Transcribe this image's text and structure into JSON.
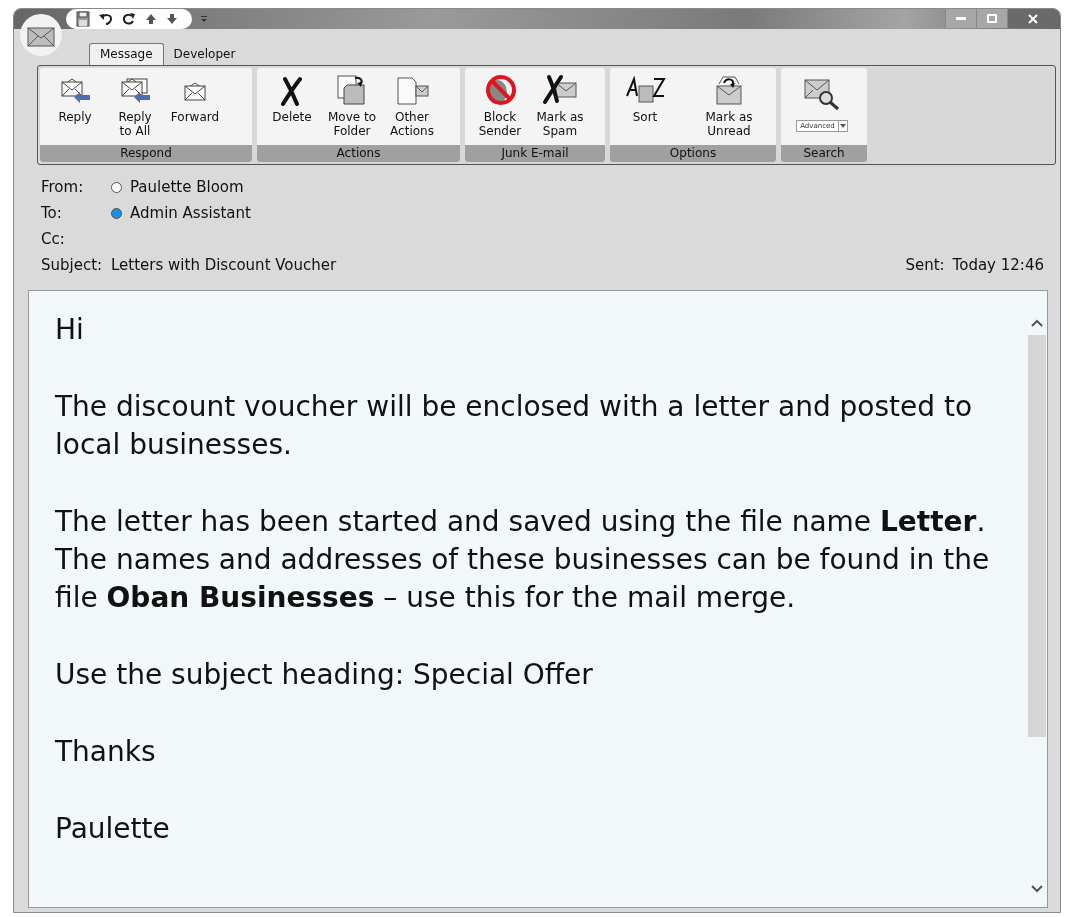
{
  "tabs": [
    {
      "label": "Message",
      "selected": true
    },
    {
      "label": "Developer",
      "selected": false
    }
  ],
  "ribbon": {
    "groups": [
      {
        "label": "Respond",
        "buttons": [
          {
            "label": "Reply"
          },
          {
            "label": "Reply\nto All"
          },
          {
            "label": "Forward"
          }
        ]
      },
      {
        "label": "Actions",
        "buttons": [
          {
            "label": "Delete"
          },
          {
            "label": "Move to\nFolder"
          },
          {
            "label": "Other\nActions"
          }
        ]
      },
      {
        "label": "Junk E-mail",
        "buttons": [
          {
            "label": "Block\nSender"
          },
          {
            "label": "Mark as\nSpam"
          }
        ]
      },
      {
        "label": "Options",
        "buttons": [
          {
            "label": "Sort"
          },
          {
            "label": "Mark as\nUnread"
          }
        ]
      },
      {
        "label": "Search",
        "dropdown": {
          "value": "Advanced"
        }
      }
    ]
  },
  "header": {
    "fields": [
      {
        "label": "From:",
        "value": "Paulette Bloom",
        "color": "#ffffff"
      },
      {
        "label": "To:",
        "value": "Admin Assistant",
        "color": "#1a8fe8"
      },
      {
        "label": "Cc:"
      },
      {
        "label": "Subject:",
        "value": "Letters with Discount Voucher"
      }
    ],
    "sent": {
      "label": "Sent:",
      "value": "Today 12:46"
    }
  },
  "body": {
    "paragraphs": [
      "Hi",
      "The discount voucher will be enclosed with a letter and posted to local businesses.",
      "The letter has been started and saved using the file name **Letter**. The names and addresses of these businesses can be found in the file **Oban Businesses** – use this for the mail merge.",
      "Use the subject heading: Special Offer",
      "Thanks",
      "Paulette"
    ]
  }
}
